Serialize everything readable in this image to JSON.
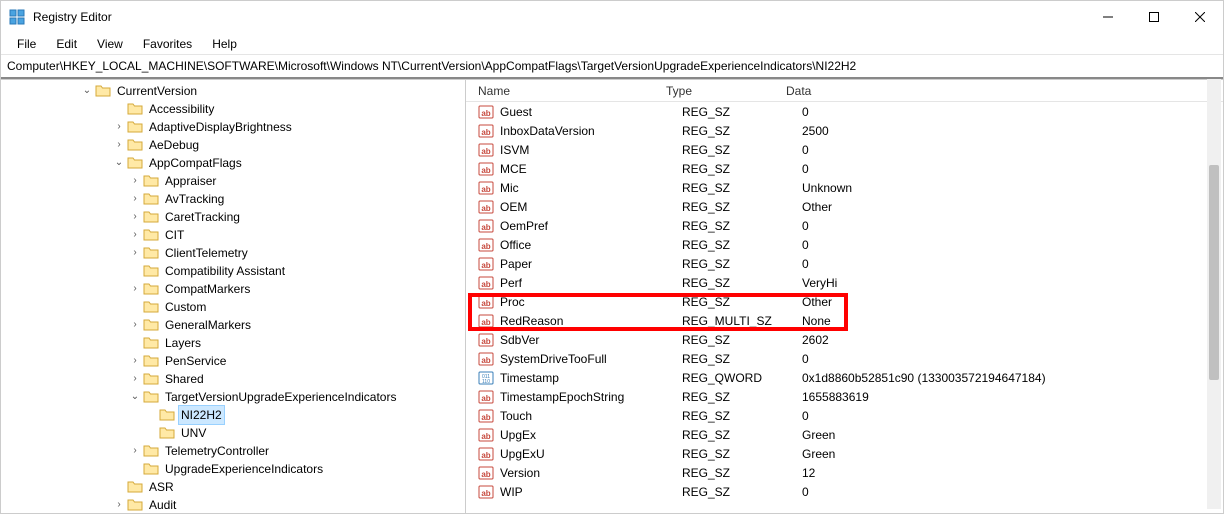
{
  "window": {
    "title": "Registry Editor"
  },
  "menu": {
    "file": "File",
    "edit": "Edit",
    "view": "View",
    "favorites": "Favorites",
    "help": "Help"
  },
  "address": "Computer\\HKEY_LOCAL_MACHINE\\SOFTWARE\\Microsoft\\Windows NT\\CurrentVersion\\AppCompatFlags\\TargetVersionUpgradeExperienceIndicators\\NI22H2",
  "tree": {
    "root_open": "CurrentVersion",
    "items": [
      {
        "label": "Accessibility",
        "depth": 1,
        "exp": ""
      },
      {
        "label": "AdaptiveDisplayBrightness",
        "depth": 1,
        "exp": ">"
      },
      {
        "label": "AeDebug",
        "depth": 1,
        "exp": ">"
      },
      {
        "label": "AppCompatFlags",
        "depth": 1,
        "exp": "v"
      },
      {
        "label": "Appraiser",
        "depth": 2,
        "exp": ">"
      },
      {
        "label": "AvTracking",
        "depth": 2,
        "exp": ">"
      },
      {
        "label": "CaretTracking",
        "depth": 2,
        "exp": ">"
      },
      {
        "label": "CIT",
        "depth": 2,
        "exp": ">"
      },
      {
        "label": "ClientTelemetry",
        "depth": 2,
        "exp": ">"
      },
      {
        "label": "Compatibility Assistant",
        "depth": 2,
        "exp": ""
      },
      {
        "label": "CompatMarkers",
        "depth": 2,
        "exp": ">"
      },
      {
        "label": "Custom",
        "depth": 2,
        "exp": ""
      },
      {
        "label": "GeneralMarkers",
        "depth": 2,
        "exp": ">"
      },
      {
        "label": "Layers",
        "depth": 2,
        "exp": ""
      },
      {
        "label": "PenService",
        "depth": 2,
        "exp": ">"
      },
      {
        "label": "Shared",
        "depth": 2,
        "exp": ">"
      },
      {
        "label": "TargetVersionUpgradeExperienceIndicators",
        "depth": 2,
        "exp": "v"
      },
      {
        "label": "NI22H2",
        "depth": 3,
        "exp": "",
        "selected": true
      },
      {
        "label": "UNV",
        "depth": 3,
        "exp": ""
      },
      {
        "label": "TelemetryController",
        "depth": 2,
        "exp": ">"
      },
      {
        "label": "UpgradeExperienceIndicators",
        "depth": 2,
        "exp": ""
      },
      {
        "label": "ASR",
        "depth": 1,
        "exp": ""
      },
      {
        "label": "Audit",
        "depth": 1,
        "exp": ">"
      }
    ]
  },
  "list": {
    "headers": {
      "name": "Name",
      "type": "Type",
      "data": "Data"
    },
    "rows": [
      {
        "name": "Guest",
        "type": "REG_SZ",
        "data": "0"
      },
      {
        "name": "InboxDataVersion",
        "type": "REG_SZ",
        "data": "2500"
      },
      {
        "name": "ISVM",
        "type": "REG_SZ",
        "data": "0"
      },
      {
        "name": "MCE",
        "type": "REG_SZ",
        "data": "0"
      },
      {
        "name": "Mic",
        "type": "REG_SZ",
        "data": "Unknown"
      },
      {
        "name": "OEM",
        "type": "REG_SZ",
        "data": "Other"
      },
      {
        "name": "OemPref",
        "type": "REG_SZ",
        "data": "0"
      },
      {
        "name": "Office",
        "type": "REG_SZ",
        "data": "0"
      },
      {
        "name": "Paper",
        "type": "REG_SZ",
        "data": "0"
      },
      {
        "name": "Perf",
        "type": "REG_SZ",
        "data": "VeryHi"
      },
      {
        "name": "Proc",
        "type": "REG_SZ",
        "data": "Other"
      },
      {
        "name": "RedReason",
        "type": "REG_MULTI_SZ",
        "data": "None",
        "highlight": true
      },
      {
        "name": "SdbVer",
        "type": "REG_SZ",
        "data": "2602"
      },
      {
        "name": "SystemDriveTooFull",
        "type": "REG_SZ",
        "data": "0"
      },
      {
        "name": "Timestamp",
        "type": "REG_QWORD",
        "data": "0x1d8860b52851c90 (133003572194647184)",
        "bin": true
      },
      {
        "name": "TimestampEpochString",
        "type": "REG_SZ",
        "data": "1655883619"
      },
      {
        "name": "Touch",
        "type": "REG_SZ",
        "data": "0"
      },
      {
        "name": "UpgEx",
        "type": "REG_SZ",
        "data": "Green"
      },
      {
        "name": "UpgExU",
        "type": "REG_SZ",
        "data": "Green"
      },
      {
        "name": "Version",
        "type": "REG_SZ",
        "data": "12"
      },
      {
        "name": "WIP",
        "type": "REG_SZ",
        "data": "0"
      }
    ]
  }
}
